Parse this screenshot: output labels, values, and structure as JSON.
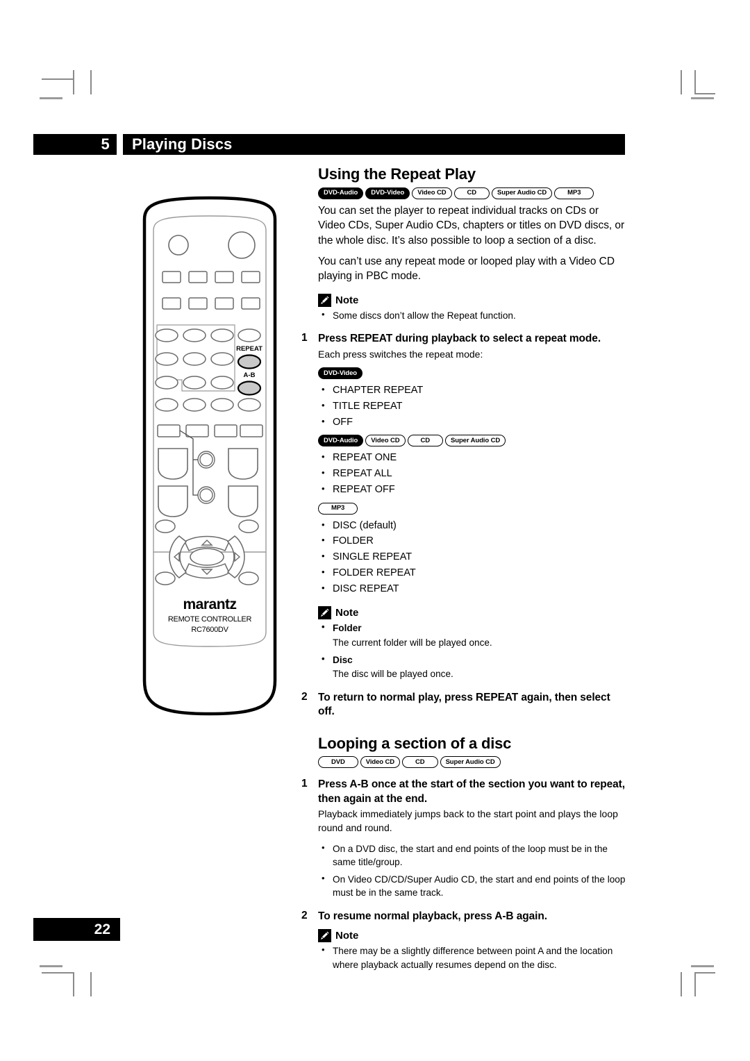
{
  "header": {
    "chapter_number": "5",
    "chapter_title": "Playing Discs"
  },
  "footer": {
    "page_number": "22"
  },
  "remote": {
    "brand": "marantz",
    "line1": "REMOTE CONTROLLER",
    "line2": "RC7600DV",
    "highlighted_buttons": [
      {
        "label": "REPEAT"
      },
      {
        "label": "A-B"
      }
    ]
  },
  "content": {
    "section1": {
      "title": "Using the Repeat Play",
      "badges": [
        {
          "label": "DVD-Audio",
          "style": "filled"
        },
        {
          "label": "DVD-Video",
          "style": "filled"
        },
        {
          "label": "Video CD",
          "style": "outline"
        },
        {
          "label": "CD",
          "style": "outline-wide"
        },
        {
          "label": "Super Audio CD",
          "style": "outline"
        },
        {
          "label": "MP3",
          "style": "outline-wide"
        }
      ],
      "paragraph1": "You can set the player to repeat individual tracks on CDs or Video CDs, Super Audio CDs, chapters or titles on DVD discs, or the whole disc. It’s also possible to loop a section of a disc.",
      "paragraph2": "You can’t use any repeat mode or looped play with a Video CD playing in PBC mode.",
      "note1": {
        "label": "Note",
        "items": [
          "Some discs don’t allow the Repeat function."
        ]
      },
      "step1": {
        "number": "1",
        "title": "Press REPEAT during playback to select a repeat mode.",
        "body": "Each press switches the repeat mode:"
      },
      "modes": [
        {
          "badges": [
            {
              "label": "DVD-Video",
              "style": "filled"
            }
          ],
          "items": [
            "CHAPTER REPEAT",
            "TITLE REPEAT",
            "OFF"
          ]
        },
        {
          "badges": [
            {
              "label": "DVD-Audio",
              "style": "filled"
            },
            {
              "label": "Video CD",
              "style": "outline"
            },
            {
              "label": "CD",
              "style": "outline-wide"
            },
            {
              "label": "Super Audio CD",
              "style": "outline"
            }
          ],
          "items": [
            "REPEAT ONE",
            "REPEAT ALL",
            "REPEAT OFF"
          ]
        },
        {
          "badges": [
            {
              "label": "MP3",
              "style": "outline-wide"
            }
          ],
          "items": [
            "DISC (default)",
            "FOLDER",
            "SINGLE REPEAT",
            "FOLDER REPEAT",
            "DISC REPEAT"
          ]
        }
      ],
      "note2": {
        "label": "Note",
        "items": [
          {
            "term": "Folder",
            "desc": "The current folder will be played once."
          },
          {
            "term": "Disc",
            "desc": "The disc will be played once."
          }
        ]
      },
      "step2": {
        "number": "2",
        "title": "To return to normal play, press REPEAT again, then select off."
      }
    },
    "section2": {
      "title": "Looping a section of a disc",
      "badges": [
        {
          "label": "DVD",
          "style": "outline-wide"
        },
        {
          "label": "Video CD",
          "style": "outline"
        },
        {
          "label": "CD",
          "style": "outline-wide"
        },
        {
          "label": "Super Audio CD",
          "style": "outline"
        }
      ],
      "step1": {
        "number": "1",
        "title": "Press A-B once at the start of the section you want to repeat, then again at the end.",
        "body": "Playback immediately jumps back to the start point and plays the loop round and round."
      },
      "bullets": [
        "On a DVD disc, the start and end points of the loop must be in the same title/group.",
        "On Video CD/CD/Super Audio CD, the start and end points of the loop must be in the same track."
      ],
      "step2": {
        "number": "2",
        "title": "To resume normal playback, press A-B again."
      },
      "note": {
        "label": "Note",
        "items": [
          "There may be a slightly difference between point A and the location where playback actually resumes depend on the disc."
        ]
      }
    }
  }
}
